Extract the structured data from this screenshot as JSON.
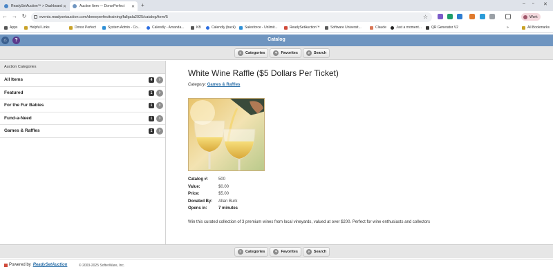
{
  "browser": {
    "tabs": [
      {
        "title": "ReadySetAuction™ > Dashboard",
        "active": false
      },
      {
        "title": "Auction Item — DonorPerfect",
        "active": true
      }
    ],
    "url": "events.readysetauction.com/donorperfecttraining/fallgala2025/catalog/item/5",
    "profile": "Work",
    "bookmarks": [
      "Apps",
      "Helpful Links",
      "Donor Perfect",
      "System Admin - Co...",
      "Calendly - Amanda...",
      "KB",
      "Calendly (back)",
      "Salesforce - Unlimit...",
      "ReadySetAuction™",
      "Software Universit...",
      "Claude",
      "Just a moment...",
      "QR Generator V2"
    ],
    "all_bookmarks": "All Bookmarks"
  },
  "header": {
    "title": "Catalog",
    "home_icon": "home-icon",
    "help_label": "?"
  },
  "subnav": {
    "categories": "Categories",
    "favorites": "Favorites",
    "search": "Search"
  },
  "sidebar": {
    "heading": "Auction Categories",
    "items": [
      {
        "label": "All Items",
        "count": "4"
      },
      {
        "label": "Featured",
        "count": "1"
      },
      {
        "label": "For the Fur Babies",
        "count": "1"
      },
      {
        "label": "Fund-a-Need",
        "count": "1"
      },
      {
        "label": "Games & Raffles",
        "count": "1"
      }
    ]
  },
  "item": {
    "title": "White Wine Raffle ($5 Dollars Per Ticket)",
    "category_label": "Category:",
    "category_value": "Games & Raffles",
    "details": [
      {
        "label": "Catalog #:",
        "value": "500"
      },
      {
        "label": "Value:",
        "value": "$0.00"
      },
      {
        "label": "Price:",
        "value": "$5.00"
      },
      {
        "label": "Donated By:",
        "value": "Allan Burk"
      },
      {
        "label": "Opens in:",
        "value": "7 minutes"
      }
    ],
    "description": "Win this curated collection of 3 premium wines from local vineyards, valued at over $200. Perfect for wine enthusiasts and collectors"
  },
  "footer": {
    "powered_by": "Powered by",
    "brand": "ReadySetAuction",
    "copyright": "© 2003-2025 SofterWare, Inc."
  },
  "colors": {
    "appbar": "#6f95c0",
    "link": "#2a6fa8",
    "badge": "#333333"
  }
}
